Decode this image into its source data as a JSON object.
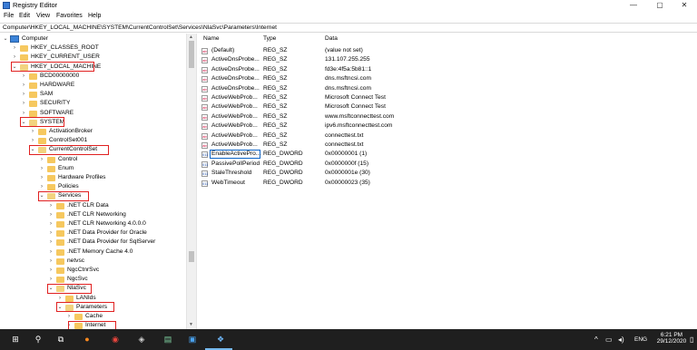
{
  "window": {
    "title": "Registry Editor",
    "minimize": "—",
    "maximize": "▢",
    "close": "✕"
  },
  "menu": [
    "File",
    "Edit",
    "View",
    "Favorites",
    "Help"
  ],
  "address": "Computer\\HKEY_LOCAL_MACHINE\\SYSTEM\\CurrentControlSet\\Services\\NlaSvc\\Parameters\\Internet",
  "tree": [
    {
      "label": "Computer",
      "expanded": true
    },
    {
      "label": "HKEY_CLASSES_ROOT"
    },
    {
      "label": "HKEY_CURRENT_USER"
    },
    {
      "label": "HKEY_LOCAL_MACHINE",
      "expanded": true,
      "highlighted": true
    },
    {
      "label": "BCD00000000"
    },
    {
      "label": "HARDWARE"
    },
    {
      "label": "SAM"
    },
    {
      "label": "SECURITY"
    },
    {
      "label": "SOFTWARE"
    },
    {
      "label": "SYSTEM",
      "expanded": true,
      "highlighted": true
    },
    {
      "label": "ActivationBroker"
    },
    {
      "label": "ControlSet001"
    },
    {
      "label": "CurrentControlSet",
      "expanded": true,
      "highlighted": true
    },
    {
      "label": "Control"
    },
    {
      "label": "Enum"
    },
    {
      "label": "Hardware Profiles"
    },
    {
      "label": "Policies"
    },
    {
      "label": "Services",
      "expanded": true,
      "highlighted": true
    },
    {
      "label": ".NET CLR Data"
    },
    {
      "label": ".NET CLR Networking"
    },
    {
      "label": ".NET CLR Networking 4.0.0.0"
    },
    {
      "label": ".NET Data Provider for Oracle"
    },
    {
      "label": ".NET Data Provider for SqlServer"
    },
    {
      "label": ".NET Memory Cache 4.0"
    },
    {
      "label": "netvsc"
    },
    {
      "label": "NgcCtnrSvc"
    },
    {
      "label": "NgcSvc"
    },
    {
      "label": "NlaSvc",
      "expanded": true,
      "highlighted": true
    },
    {
      "label": "LANIds"
    },
    {
      "label": "Parameters",
      "expanded": true,
      "highlighted": true
    },
    {
      "label": "Cache"
    },
    {
      "label": "Internet",
      "highlighted": true,
      "selected": true
    }
  ],
  "columns": {
    "name": "Name",
    "type": "Type",
    "data": "Data"
  },
  "values": [
    {
      "name": "(Default)",
      "type": "REG_SZ",
      "data": "(value not set)",
      "kind": "sz"
    },
    {
      "name": "ActiveDnsProbe...",
      "type": "REG_SZ",
      "data": "131.107.255.255",
      "kind": "sz"
    },
    {
      "name": "ActiveDnsProbe...",
      "type": "REG_SZ",
      "data": "fd3e:4f5a:5b81::1",
      "kind": "sz"
    },
    {
      "name": "ActiveDnsProbe...",
      "type": "REG_SZ",
      "data": "dns.msftncsi.com",
      "kind": "sz"
    },
    {
      "name": "ActiveDnsProbe...",
      "type": "REG_SZ",
      "data": "dns.msftncsi.com",
      "kind": "sz"
    },
    {
      "name": "ActiveWebProb...",
      "type": "REG_SZ",
      "data": "Microsoft Connect Test",
      "kind": "sz"
    },
    {
      "name": "ActiveWebProb...",
      "type": "REG_SZ",
      "data": "Microsoft Connect Test",
      "kind": "sz"
    },
    {
      "name": "ActiveWebProb...",
      "type": "REG_SZ",
      "data": "www.msftconnecttest.com",
      "kind": "sz"
    },
    {
      "name": "ActiveWebProb...",
      "type": "REG_SZ",
      "data": "ipv6.msftconnecttest.com",
      "kind": "sz"
    },
    {
      "name": "ActiveWebProb...",
      "type": "REG_SZ",
      "data": "connecttest.txt",
      "kind": "sz"
    },
    {
      "name": "ActiveWebProb...",
      "type": "REG_SZ",
      "data": "connecttest.txt",
      "kind": "sz"
    },
    {
      "name": "EnableActivePro...",
      "type": "REG_DWORD",
      "data": "0x00000001 (1)",
      "kind": "dword",
      "selected": true
    },
    {
      "name": "PassivePollPeriod",
      "type": "REG_DWORD",
      "data": "0x0000000f (15)",
      "kind": "dword"
    },
    {
      "name": "StaleThreshold",
      "type": "REG_DWORD",
      "data": "0x0000001e (30)",
      "kind": "dword"
    },
    {
      "name": "WebTimeout",
      "type": "REG_DWORD",
      "data": "0x00000023 (35)",
      "kind": "dword"
    }
  ],
  "taskbar": {
    "icons": [
      "start-icon",
      "search-icon",
      "task-view-icon",
      "firefox-icon",
      "chrome-icon",
      "app-icon",
      "notes-icon",
      "photos-icon",
      "regedit-icon"
    ],
    "language": "ENG",
    "time": "6:21 PM",
    "date": "29/12/2020"
  },
  "colors": {
    "highlight": "#e02020",
    "selection": "#0a64c8",
    "folder": "#f6c85f",
    "taskbar": "#1f1f1f"
  }
}
